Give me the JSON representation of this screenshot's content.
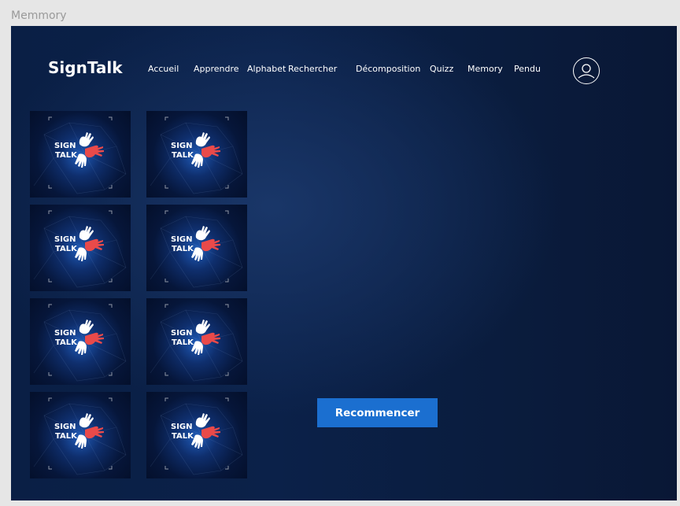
{
  "frame_label": "Memmory",
  "header": {
    "brand": "SignTalk",
    "nav": [
      "Accueil",
      "Apprendre",
      "Alphabet",
      "Rechercher",
      "Décomposition",
      "Quizz",
      "Memory",
      "Pendu"
    ],
    "profile_icon": "user-icon"
  },
  "memory": {
    "card_count": 8,
    "card_back_logo_line1": "SIGN",
    "card_back_logo_line2": "TALK",
    "restart_label": "Recommencer"
  },
  "colors": {
    "background": "#0b2149",
    "button": "#1b6fd0",
    "accent_red": "#e94a4a"
  }
}
